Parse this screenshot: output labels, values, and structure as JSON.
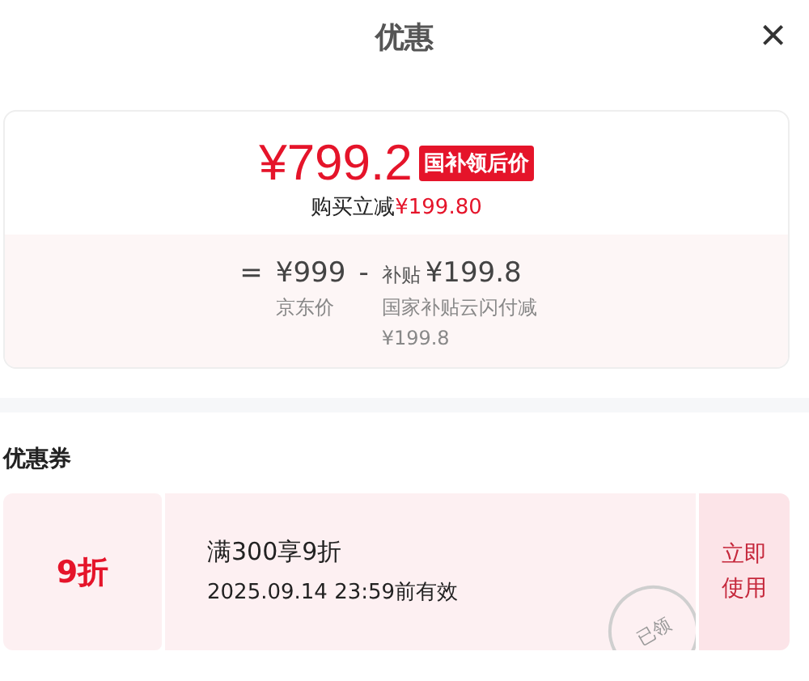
{
  "header": {
    "title": "优惠",
    "close": "×"
  },
  "price_card": {
    "price": "¥799.2",
    "price_tag": "国补领后价",
    "saving_label": "购买立减",
    "saving_value": "¥199.80",
    "breakdown": {
      "equals": "=",
      "base_price": "¥999",
      "minus": "-",
      "subsidy_label": "补贴",
      "subsidy_price": "¥199.8",
      "base_caption": "京东价",
      "subsidy_caption": "国家补贴云闪付减",
      "subsidy_amount": "¥199.8"
    }
  },
  "coupons_section": {
    "title": "优惠券",
    "coupons": [
      {
        "discount": "9折",
        "condition": "满300享9折",
        "validity": "2025.09.14 23:59前有效",
        "stamp": "已领",
        "claimed": true,
        "action": "立即使用"
      }
    ]
  }
}
